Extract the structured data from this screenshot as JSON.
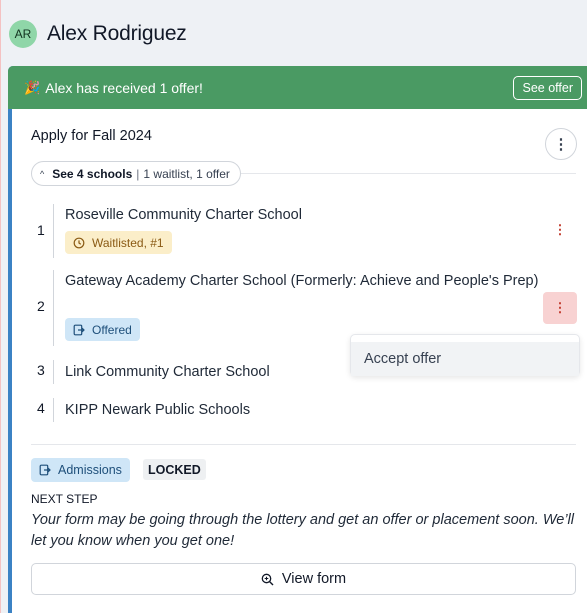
{
  "header": {
    "avatar_initials": "AR",
    "name": "Alex Rodriguez"
  },
  "banner": {
    "emoji": "🎉",
    "message": "Alex has received 1 offer!",
    "button_label": "See offer",
    "color": "#4a9a63"
  },
  "application": {
    "title": "Apply for Fall 2024",
    "schools_toggle": {
      "label": "See 4 schools",
      "summary": "1 waitlist, 1 offer"
    },
    "schools": [
      {
        "number": "1",
        "name": "Roseville Community Charter School",
        "status": "Waitlisted, #1",
        "status_icon": "clock-icon"
      },
      {
        "number": "2",
        "name": "Gateway Academy Charter School (Formerly: Achieve and People's Prep)",
        "status": "Offered",
        "status_icon": "exit-icon"
      },
      {
        "number": "3",
        "name": "Link Community Charter School"
      },
      {
        "number": "4",
        "name": "KIPP Newark Public Schools"
      }
    ],
    "menu": {
      "accept_offer": "Accept offer"
    },
    "admissions_badge": "Admissions",
    "locked_badge": "LOCKED",
    "next_step_label": "NEXT STEP",
    "next_step_text": "Your form may be going through the lottery and get an offer or placement soon. We’ll let you know when you get one!",
    "view_form_label": "View form"
  },
  "colors": {
    "accent_left": "#3b82c4",
    "waitlist_bg": "#fbeec9",
    "offered_bg": "#cfe6f7",
    "kebab_red": "#c0392b"
  }
}
